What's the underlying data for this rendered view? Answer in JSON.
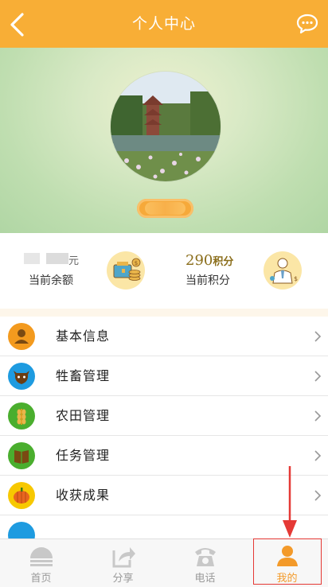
{
  "header": {
    "title": "个人中心",
    "back_icon": "chevron-left-icon",
    "message_icon": "chat-bubble-icon"
  },
  "profile": {
    "avatar_icon": "landscape-avatar-photo",
    "name": ""
  },
  "stats": {
    "balance_label": "当前余额",
    "balance_value_partial": "元",
    "balance_icon": "wallet-coins-icon",
    "points_value": "290",
    "points_unit": "积分",
    "points_label": "当前积分",
    "points_icon": "businessman-icon"
  },
  "menu": {
    "items": [
      {
        "label": "基本信息",
        "icon": "person-icon",
        "color": "#F39A1E"
      },
      {
        "label": "牲畜管理",
        "icon": "cow-icon",
        "color": "#1E9BE0"
      },
      {
        "label": "农田管理",
        "icon": "wheat-icon",
        "color": "#4AAE2E"
      },
      {
        "label": "任务管理",
        "icon": "book-icon",
        "color": "#4AAE2E"
      },
      {
        "label": "收获成果",
        "icon": "pumpkin-icon",
        "color": "#F7C800"
      }
    ]
  },
  "tabbar": {
    "tabs": [
      {
        "label": "首页",
        "icon": "home-icon"
      },
      {
        "label": "分享",
        "icon": "share-icon"
      },
      {
        "label": "电话",
        "icon": "phone-icon"
      },
      {
        "label": "我的",
        "icon": "user-icon"
      }
    ],
    "active_index": 3
  },
  "colors": {
    "accent": "#F8AE36",
    "active_tab": "#F39A2A",
    "annotation": "#E53935"
  }
}
